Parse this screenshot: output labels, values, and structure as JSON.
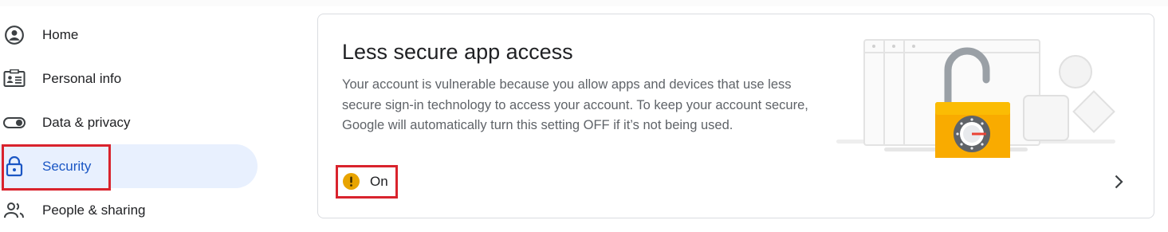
{
  "sidebar": {
    "items": [
      {
        "label": "Home",
        "icon": "account-circle-icon"
      },
      {
        "label": "Personal info",
        "icon": "id-card-icon"
      },
      {
        "label": "Data & privacy",
        "icon": "toggle-icon"
      },
      {
        "label": "Security",
        "icon": "lock-icon",
        "active": true
      },
      {
        "label": "People & sharing",
        "icon": "people-icon"
      }
    ]
  },
  "card": {
    "title": "Less secure app access",
    "description": "Your account is vulnerable because you allow apps and devices that use less secure sign-in technology to access your account. To keep your account secure, Google will automatically turn this setting OFF if it’s not being used.",
    "status_label": "On",
    "status_icon": "warning-icon"
  },
  "colors": {
    "active_bg": "#e8f0fe",
    "active_text": "#1a56c4",
    "highlight_box": "#d9232d",
    "warning": "#e8a400",
    "lock_body": "#f9ab00"
  }
}
